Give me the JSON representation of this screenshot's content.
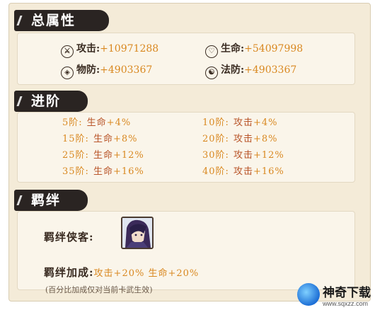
{
  "total": {
    "title": "总属性",
    "attack_label": "攻击:",
    "attack_value": "+10971288",
    "hp_label": "生命:",
    "hp_value": "+54097998",
    "pdef_label": "物防:",
    "pdef_value": "+4903367",
    "mdef_label": "法防:",
    "mdef_value": "+4903367"
  },
  "advance": {
    "title": "进阶",
    "rows": [
      {
        "left_lvl": "5阶:",
        "left_eff": "生命",
        "left_pct": "+4%",
        "right_lvl": "10阶:",
        "right_eff": "攻击",
        "right_pct": "+4%"
      },
      {
        "left_lvl": "15阶:",
        "left_eff": "生命",
        "left_pct": "+8%",
        "right_lvl": "20阶:",
        "right_eff": "攻击",
        "right_pct": "+8%"
      },
      {
        "left_lvl": "25阶:",
        "left_eff": "生命",
        "left_pct": "+12%",
        "right_lvl": "30阶:",
        "right_eff": "攻击",
        "right_pct": "+12%"
      },
      {
        "left_lvl": "35阶:",
        "left_eff": "生命",
        "left_pct": "+16%",
        "right_lvl": "40阶:",
        "right_eff": "攻击",
        "right_pct": "+16%"
      }
    ]
  },
  "bond": {
    "title": "羁绊",
    "hero_label": "羁绊侠客:",
    "bonus_label": "羁绊加成:",
    "bonus_text": "攻击+20% 生命+20%",
    "note": "(百分比加成仅对当前卡武生效)"
  },
  "watermark": {
    "name": "神奇下载",
    "url": "www.sqxzz.com"
  }
}
